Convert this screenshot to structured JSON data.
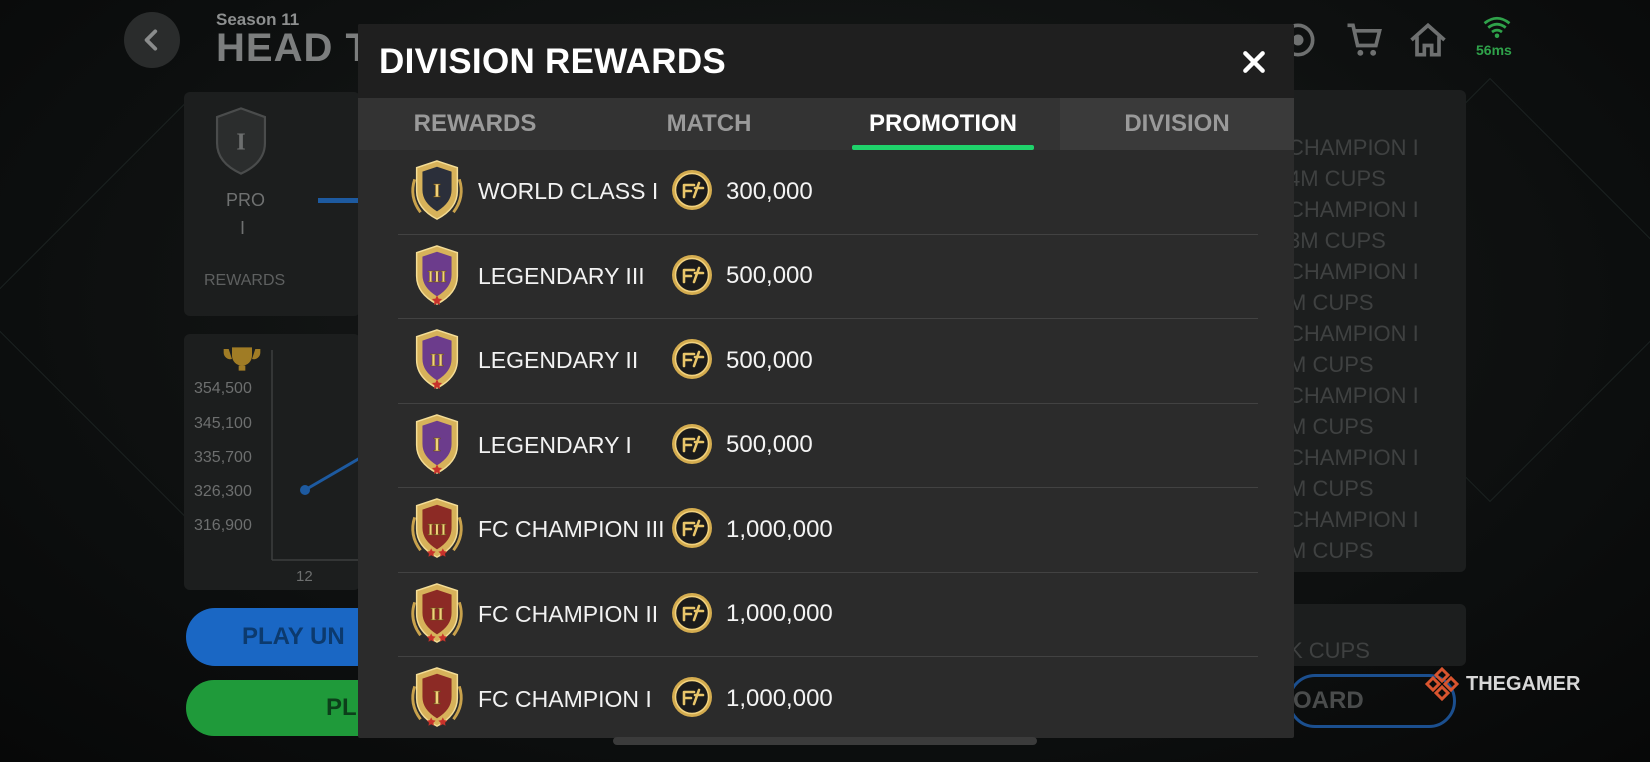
{
  "background": {
    "season": "Season 11",
    "title": "HEAD T",
    "ping": "56ms",
    "pro_label": "PRO",
    "pro_rank": "I",
    "rewards_label": "REWARDS",
    "chart_y_labels": [
      "354,500",
      "345,100",
      "335,700",
      "326,300",
      "316,900"
    ],
    "chart_x_label": "12",
    "play_button_label": "PLAY UN",
    "play_button2_label": "PL",
    "right_list": [
      {
        "line1": "CHAMPION I",
        "line2": "4M CUPS"
      },
      {
        "line1": "CHAMPION I",
        "line2": "3M CUPS"
      },
      {
        "line1": "CHAMPION I",
        "line2": "M CUPS"
      },
      {
        "line1": "CHAMPION I",
        "line2": "M CUPS"
      },
      {
        "line1": "CHAMPION I",
        "line2": "M CUPS"
      },
      {
        "line1": "CHAMPION I",
        "line2": "M CUPS"
      },
      {
        "line1": "CHAMPION I",
        "line2": "M CUPS"
      }
    ],
    "right_bottom": {
      "line1": "I",
      "line2": "K CUPS"
    },
    "board_button_label": "OARD"
  },
  "modal": {
    "title": "DIVISION REWARDS",
    "tabs": [
      {
        "label": "REWARDS",
        "active": false
      },
      {
        "label": "MATCH",
        "active": false
      },
      {
        "label": "PROMOTION",
        "active": true
      },
      {
        "label": "DIVISION",
        "active": false
      }
    ],
    "rows": [
      {
        "division": "WORLD CLASS I",
        "amount": "300,000",
        "tier": "world-class",
        "rank": "I",
        "stars": 0
      },
      {
        "division": "LEGENDARY III",
        "amount": "500,000",
        "tier": "legendary",
        "rank": "III",
        "stars": 1
      },
      {
        "division": "LEGENDARY II",
        "amount": "500,000",
        "tier": "legendary",
        "rank": "II",
        "stars": 1
      },
      {
        "division": "LEGENDARY I",
        "amount": "500,000",
        "tier": "legendary",
        "rank": "I",
        "stars": 1
      },
      {
        "division": "FC CHAMPION III",
        "amount": "1,000,000",
        "tier": "fc-champion",
        "rank": "III",
        "stars": 2
      },
      {
        "division": "FC CHAMPION II",
        "amount": "1,000,000",
        "tier": "fc-champion",
        "rank": "II",
        "stars": 2
      },
      {
        "division": "FC CHAMPION I",
        "amount": "1,000,000",
        "tier": "fc-champion",
        "rank": "I",
        "stars": 2
      }
    ]
  },
  "watermark": "THEGAMER",
  "colors": {
    "accent_green": "#1fd36b",
    "gold": "#d7b25a",
    "world_class_center": "#2b2f3a",
    "legendary_center": "#6c3c8c",
    "fc_champion_center": "#8c2a25"
  }
}
